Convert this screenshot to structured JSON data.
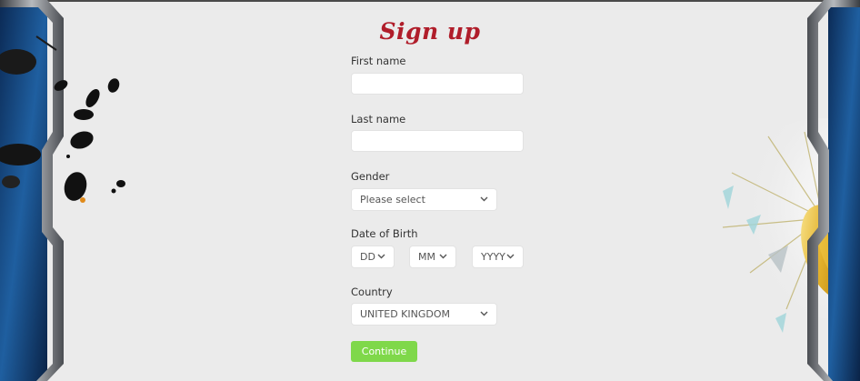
{
  "form": {
    "title": "Sign up",
    "first_name_label": "First name",
    "last_name_label": "Last name",
    "gender_label": "Gender",
    "gender_value": "Please select",
    "dob_label": "Date of Birth",
    "dob_day": "DD",
    "dob_month": "MM",
    "dob_year": "YYYY",
    "country_label": "Country",
    "country_value": "UNITED KINGDOM",
    "continue_label": "Continue"
  },
  "colors": {
    "background": "#ebebeb",
    "title": "#b01d2a",
    "continue_button": "#7fd84a"
  }
}
